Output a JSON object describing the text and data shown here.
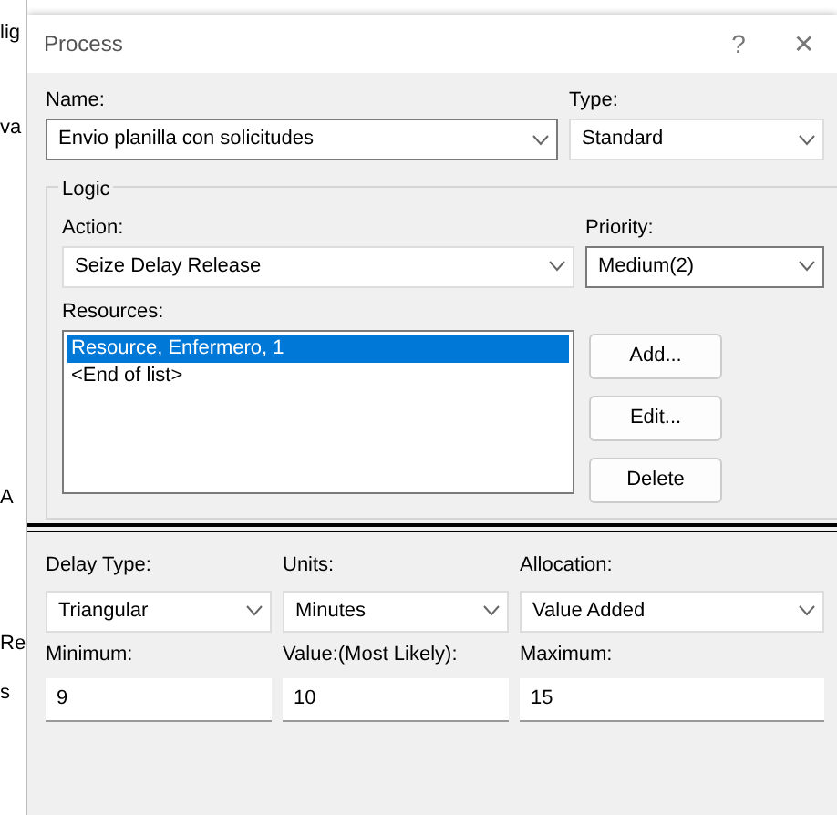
{
  "background": {
    "fragments": [
      "lig",
      "va",
      "A",
      "Re",
      "s"
    ]
  },
  "window": {
    "title": "Process",
    "help": "?",
    "close": "✕"
  },
  "name": {
    "label": "Name:",
    "value": "Envio planilla con solicitudes"
  },
  "type": {
    "label": "Type:",
    "value": "Standard"
  },
  "logic": {
    "title": "Logic",
    "action": {
      "label": "Action:",
      "value": "Seize Delay Release"
    },
    "priority": {
      "label": "Priority:",
      "value": "Medium(2)"
    },
    "resources": {
      "label": "Resources:",
      "items": [
        {
          "text": "Resource, Enfermero, 1",
          "selected": true
        },
        {
          "text": "<End of list>",
          "selected": false
        }
      ]
    },
    "buttons": [
      "Add...",
      "Edit...",
      "Delete"
    ]
  },
  "delay": {
    "dropdowns": [
      {
        "label": "Delay Type:",
        "value": "Triangular"
      },
      {
        "label": "Units:",
        "value": "Minutes"
      },
      {
        "label": "Allocation:",
        "value": "Value Added"
      }
    ],
    "fields": [
      {
        "label": "Minimum:",
        "value": "9"
      },
      {
        "label": "Value:(Most Likely):",
        "value": "10"
      },
      {
        "label": "Maximum:",
        "value": "15"
      }
    ]
  }
}
